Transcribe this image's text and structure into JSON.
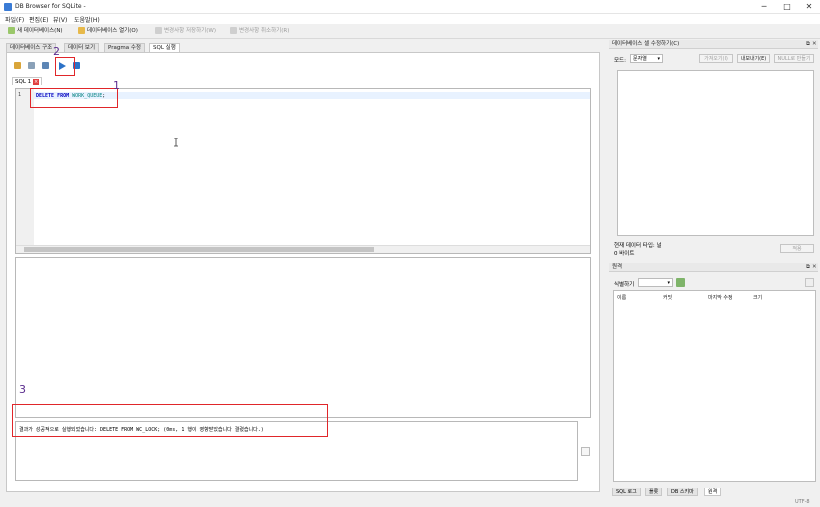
{
  "window": {
    "title": "DB Browser for SQLite -",
    "min": "─",
    "max": "□",
    "close": "✕"
  },
  "menu": [
    "파일(F)",
    "편집(E)",
    "뷰(V)",
    "도움말(H)"
  ],
  "toolbar": {
    "new_db": "새 데이터베이스(N)",
    "open_db": "데이터베이스 열기(O)",
    "write_changes": "변경사항 저장하기(W)",
    "revert_changes": "변경사항 취소하기(R)"
  },
  "tabs": [
    "데이터베이스 구조",
    "데이터 보기",
    "Pragma 수정",
    "SQL 실행"
  ],
  "sql": {
    "inner_tab": "SQL 1",
    "line_number": "1",
    "code_kw": "DELETE FROM",
    "code_table": "WORK_QUEUE",
    "code_end": ";",
    "message": "결과가 성공적으로 실행되었습니다: DELETE FROM WC_LOCK; (0ms, 1 행이 영향받았습니다 결렸습니다.)"
  },
  "annotations": [
    "1",
    "2",
    "3"
  ],
  "cell_editor": {
    "title": "데이터베이스 셀 수정하기(C)",
    "mode_label": "모드:",
    "mode_value": "문자열",
    "import_btn": "가져오기(I)",
    "export_btn": "내보내기(E)",
    "null_btn": "NULL로 만들기",
    "type_text": "현재 데이터 타입: 널",
    "size_text": "0 바이트",
    "apply_btn": "적용"
  },
  "remote": {
    "title": "원격",
    "identity_label": "식별하기",
    "columns": [
      "이름",
      "커밋",
      "마지막 수정",
      "크기"
    ]
  },
  "bottom_tabs": [
    "SQL 로그",
    "플롯",
    "DB 스키마",
    "원격"
  ],
  "status": {
    "encoding": "UTF-8"
  },
  "colors": {
    "accent": "#3a7bd5",
    "annotation_box": "#e0262a",
    "annotation_text": "#5b2d8e"
  }
}
